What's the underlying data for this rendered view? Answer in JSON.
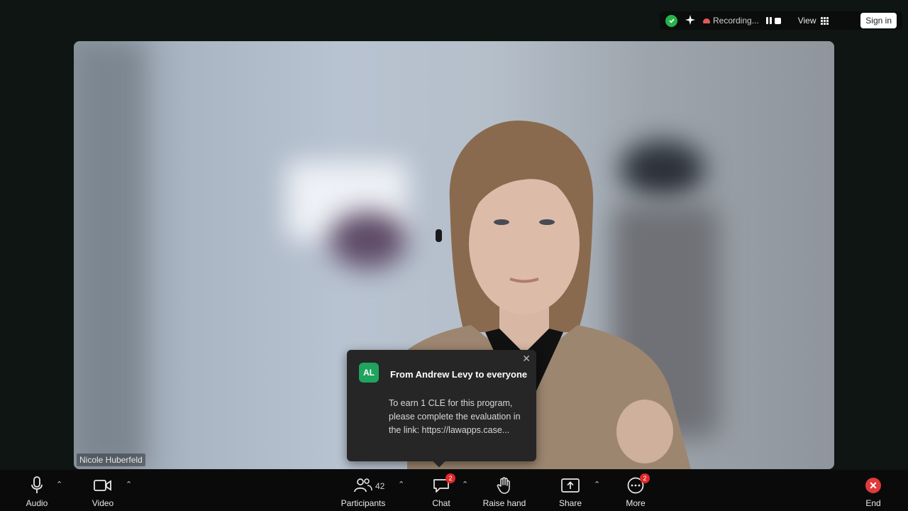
{
  "topbar": {
    "recording_label": "Recording...",
    "view_label": "View",
    "signin_label": "Sign in",
    "icons": [
      "shield-check-icon",
      "sparkle-icon",
      "cloud-record-icon",
      "pause-icon",
      "stop-icon",
      "grid-icon"
    ]
  },
  "video": {
    "participant_name": "Nicole Huberfeld"
  },
  "chat_toast": {
    "avatar_initials": "AL",
    "from": "From Andrew Levy to everyone",
    "message": "To earn 1 CLE for this program, please complete the evaluation in the link: https://lawapps.case..."
  },
  "toolbar": {
    "audio": "Audio",
    "video": "Video",
    "participants": "Participants",
    "participant_count": "42",
    "chat": "Chat",
    "chat_badge": "2",
    "raise_hand": "Raise hand",
    "share": "Share",
    "more": "More",
    "more_badge": "2",
    "end": "End"
  },
  "colors": {
    "accent_green": "#25b34a",
    "avatar_green": "#1fa35e",
    "end_red": "#e03a3a",
    "badge_red": "#e02828"
  }
}
